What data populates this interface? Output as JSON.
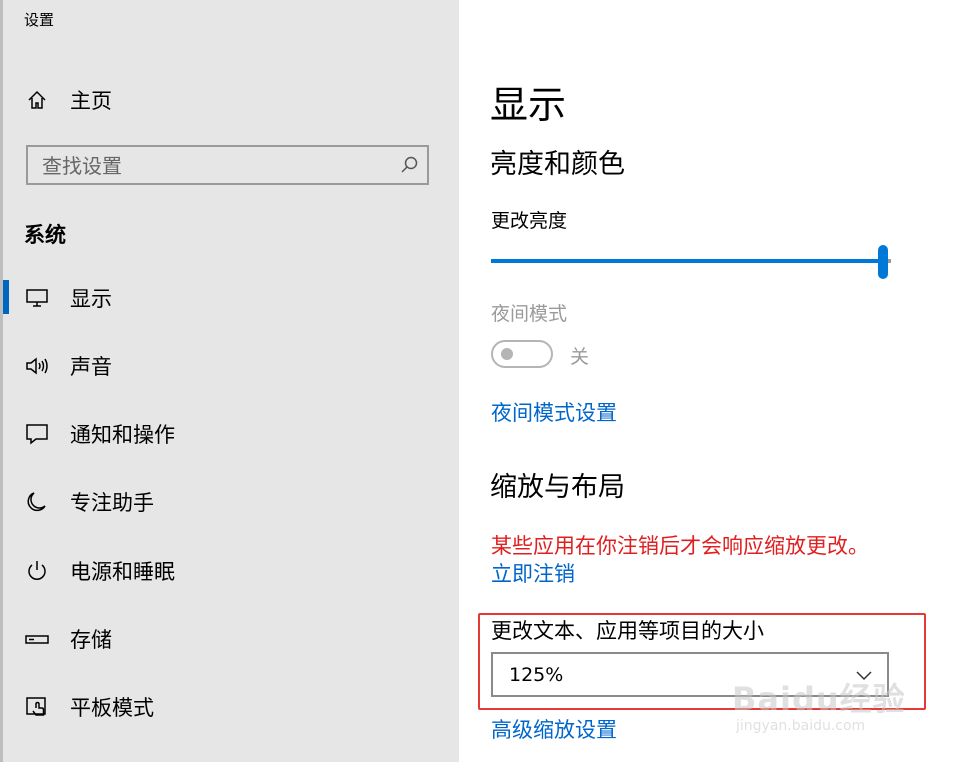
{
  "window": {
    "title": "设置"
  },
  "sidebar": {
    "home_label": "主页",
    "search": {
      "placeholder": "查找设置"
    },
    "section_heading": "系统",
    "items": [
      {
        "label": "显示",
        "icon": "monitor-icon",
        "selected": true
      },
      {
        "label": "声音",
        "icon": "speaker-icon"
      },
      {
        "label": "通知和操作",
        "icon": "notification-icon"
      },
      {
        "label": "专注助手",
        "icon": "moon-icon"
      },
      {
        "label": "电源和睡眠",
        "icon": "power-icon"
      },
      {
        "label": "存储",
        "icon": "storage-icon"
      },
      {
        "label": "平板模式",
        "icon": "tablet-mode-icon"
      }
    ]
  },
  "main": {
    "title": "显示",
    "brightness_section": {
      "heading": "亮度和颜色",
      "slider_label": "更改亮度",
      "brightness_value": 1.0,
      "night_mode_label": "夜间模式",
      "night_mode_state": "关",
      "night_mode_link": "夜间模式设置"
    },
    "scale_section": {
      "heading": "缩放与布局",
      "warning": "某些应用在你注销后才会响应缩放更改。",
      "signout_link": "立即注销",
      "size_label": "更改文本、应用等项目的大小",
      "size_value": "125%",
      "advanced_link": "高级缩放设置"
    }
  },
  "watermark": {
    "main": "Baidu经验",
    "sub": "jingyan.baidu.com"
  },
  "colors": {
    "accent": "#0078d7",
    "link": "#0066cc",
    "warning": "#e02020",
    "sidebar_bg": "#e6e6e6",
    "highlight": "#e53935"
  }
}
